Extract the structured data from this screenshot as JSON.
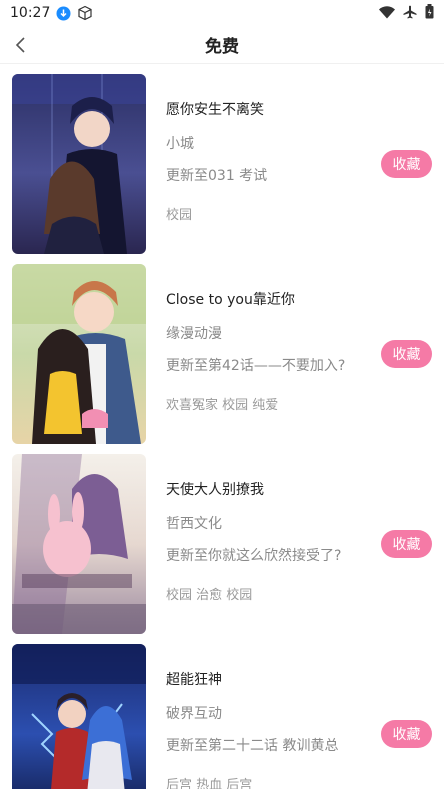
{
  "status_bar": {
    "time": "10:27"
  },
  "header": {
    "title": "免费"
  },
  "comics": [
    {
      "title": "愿你安生不离笑",
      "author": "小城",
      "update": "更新至031 考试",
      "tags": "校园",
      "fav_label": "收藏"
    },
    {
      "title": "Close to you靠近你",
      "author": "缘漫动漫",
      "update": "更新至第42话——不要加入?",
      "tags": "欢喜冤家 校园 纯爱",
      "fav_label": "收藏"
    },
    {
      "title": "天使大人别撩我",
      "author": "哲西文化",
      "update": "更新至你就这么欣然接受了?",
      "tags": "校园 治愈 校园",
      "fav_label": "收藏"
    },
    {
      "title": "超能狂神",
      "author": "破界互动",
      "update": "更新至第二十二话 教训黄总",
      "tags": "后宫 热血 后宫",
      "fav_label": "收藏"
    }
  ],
  "colors": {
    "accent": "#f57aa6",
    "text_primary": "#222222",
    "text_secondary": "#8a8a8a"
  }
}
